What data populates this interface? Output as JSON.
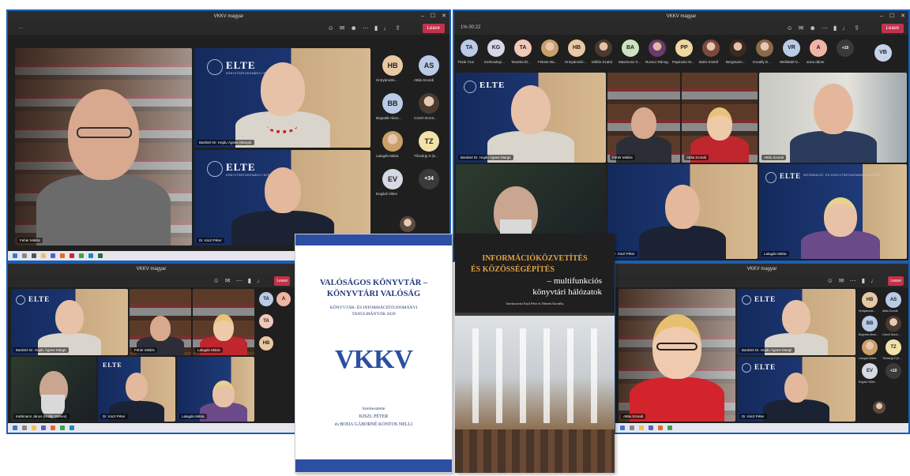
{
  "window_title": "VKKV magyar",
  "top_left_toolbar_text": "...",
  "top_right_toolbar_text": "1% 00:22",
  "leave_label": "Leave",
  "more_count": "+34",
  "more_count_small": "+10",
  "more_count_br": "+10",
  "elte": {
    "logo": "ELTE",
    "subtitle": "KÖNYVTÁRTUDOMÁNYI INTÉZET",
    "subtitle_long": "INFORMÁCIÓ- ÉS KÖNYVTÁRTUDOMÁNYI INTÉZET"
  },
  "tl": {
    "main_name": "Fehér Miklós",
    "top_right_name": "Barátné Dr. Hajdu Ágnes (Margit)",
    "bottom_right_name": "Dr. Kiszl Péter",
    "avatars": [
      {
        "initials": "HB",
        "label": "Hrotyánszki...",
        "color": "#e8c9a2"
      },
      {
        "initials": "AS",
        "label": "Attila Szondi",
        "color": "#b9cbe6"
      },
      {
        "initials": "BB",
        "label": "Bogodár Aboo...",
        "color": "#b9cbe6"
      },
      {
        "initials": "",
        "label": "Czech Dorot...",
        "color": "#d8d0c4"
      },
      {
        "initials": "",
        "label": "Lalugdo Mária",
        "color": "#c8b6a8"
      },
      {
        "initials": "TZ",
        "label": "Tőzsérgi Z.(S...",
        "color": "#f2e1a9"
      },
      {
        "initials": "EV",
        "label": "Engárd Viktor",
        "color": "#d5d9e4"
      }
    ]
  },
  "tr": {
    "chips": [
      {
        "initials": "TA",
        "label": "Tóvár Ácsi",
        "color": "#b9cbe6"
      },
      {
        "initials": "KG",
        "label": "Kerkoványi...",
        "color": "#d5d9e4"
      },
      {
        "initials": "TA",
        "label": "Tavarka Ér...",
        "color": "#f0c9b8"
      },
      {
        "initials": "",
        "label": "Fekete Ba...",
        "color": "#d8c4a8"
      },
      {
        "initials": "HB",
        "label": "Hrotyánszki...",
        "color": "#e8c9a2"
      },
      {
        "initials": "",
        "label": "Mihlár Szabó",
        "color": "#caa890"
      },
      {
        "initials": "BA",
        "label": "Maximosz K...",
        "color": "#cfe2c0"
      },
      {
        "initials": "",
        "label": "Ruzsor Ránog",
        "color": "#a88f7c"
      },
      {
        "initials": "PP",
        "label": "Papirusto M...",
        "color": "#f2d6a0"
      },
      {
        "initials": "",
        "label": "Bakó Kristóf",
        "color": "#c9b8a8"
      },
      {
        "initials": "",
        "label": "Bergmann...",
        "color": "#c49a80"
      },
      {
        "initials": "",
        "label": "Kovafly D...",
        "color": "#b6a08f"
      },
      {
        "initials": "VR",
        "label": "Wehiltakl N...",
        "color": "#b9cbe6"
      },
      {
        "initials": "A",
        "label": "anna dáner",
        "color": "#f0b4a4"
      }
    ],
    "side_chip": {
      "initials": "VB",
      "color": "#c6d3ec"
    },
    "names": [
      "Barátné Dr. Hajdu Ágnes Margit",
      "Fehér Miklós",
      "Attila Szondi",
      "Lalugdo Mária"
    ]
  },
  "bl": {
    "names": [
      "Barátné Dr. Hajdu Ágnes Margit",
      "Fehér Miklós",
      "Lalugdo Mária",
      "Dr. Kiszl Péter",
      "Kahlmann János (Kolibri Dénes)"
    ],
    "chips": [
      {
        "initials": "TA",
        "color": "#b9cbe6"
      },
      {
        "initials": "A",
        "color": "#f0b4a4"
      },
      {
        "initials": "TA",
        "color": "#f0c9b8"
      },
      {
        "initials": "HB",
        "color": "#e8c9a2"
      }
    ]
  },
  "br": {
    "names": [
      "Barátné Dr. Hajdu Ágnes Margit",
      "Fehér Miklós",
      "Dr. Kiszl Péter"
    ],
    "chips": [
      {
        "initials": "HB",
        "label": "Hrotyánszki...",
        "color": "#e8c9a2"
      },
      {
        "initials": "AS",
        "label": "Attila Szondi",
        "color": "#b9cbe6"
      },
      {
        "initials": "BB",
        "label": "Bogodár Aboo...",
        "color": "#b9cbe6"
      },
      {
        "initials": "",
        "label": "Czech Dorot...",
        "color": "#d8d0c4"
      },
      {
        "initials": "",
        "label": "Lalugdo Mária",
        "color": "#c8b6a8"
      },
      {
        "initials": "TZ",
        "label": "Tőzsérgi Z.(S...",
        "color": "#f2e1a9"
      },
      {
        "initials": "EV",
        "label": "Engárd Viktor",
        "color": "#d5d9e4"
      }
    ]
  },
  "book1": {
    "title_line1": "VALÓSÁGOS KÖNYVTÁR –",
    "title_line2": "KÖNYVTÁRI VALÓSÁG",
    "subtitle_line1": "KÖNYVTÁR- ÉS INFORMÁCIÓTUDOMÁNYI",
    "subtitle_line2": "TANULMÁNYOK 2020",
    "logo": "VKKV",
    "editors_label": "Szerkesztette",
    "editor1": "KISZL PÉTER",
    "editor2": "és BODA GÁBORNÉ KONTOS NELLI"
  },
  "book2": {
    "title_line1": "INFORMÁCIÓKÖZVETÍTÉS",
    "title_line2": "ÉS KÖZÖSSÉGÉPÍTÉS",
    "title_line3": "– multifunkciós",
    "title_line4": "könyvtári hálózatok",
    "editors": "Szerkesztette Kiszl Péter és Németh Kornélia"
  },
  "colors": {
    "frame": "#1a5fb4",
    "teams_dark": "#1f1f1f",
    "leave_red": "#c4314b",
    "elte_navy": "#142a5c",
    "elte_gold": "#c9a980",
    "book1_title": "#243a7a",
    "book2_title": "#e0a247"
  }
}
